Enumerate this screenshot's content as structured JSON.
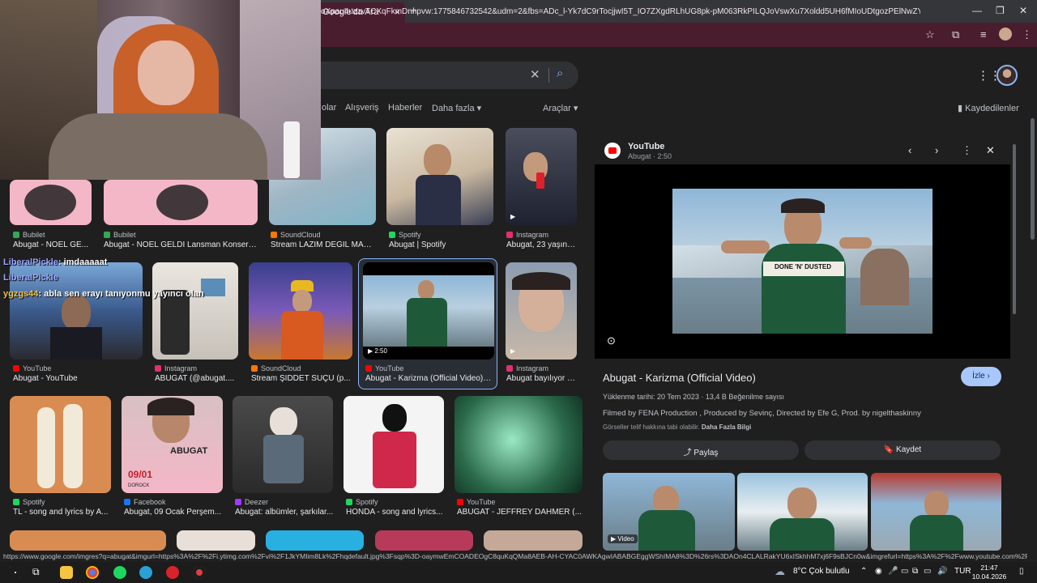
{
  "browser": {
    "tab_title": "Google'da Ara",
    "tab_close": "×",
    "new_tab": "+",
    "url": "oXpau4uzzvTCXqFkmDnnpvw:1775846732542&udm=2&fbs=ADc_l-Yk7dC9rTocjjwI5T_IO7ZXgdRLhUG8pk-pM063RkPILQJoVswXu7Xoldd5UH6fMIoUDtgozPElNwZYSjs_WJgHI0H2...",
    "window_controls": [
      "—",
      "❐",
      "✕"
    ]
  },
  "google": {
    "nav_items": [
      "olar",
      "Alışveriş",
      "Haberler",
      "Daha fazla ▾"
    ],
    "tools": "Araçlar ▾",
    "saved": "Kaydedilenler"
  },
  "results": [
    {
      "source": "Bubilet",
      "caption": "Abugat - NOEL GE...",
      "fav_color": "#34a853"
    },
    {
      "source": "Bubilet",
      "caption": "Abugat - NOEL GELDİ Lansman Konseri ...",
      "fav_color": "#34a853"
    },
    {
      "source": "SoundCloud",
      "caption": "Stream LAZIM DEĞİL MAG...",
      "fav_color": "#ff7700"
    },
    {
      "source": "Spotify",
      "caption": "Abugat | Spotify",
      "fav_color": "#1ed760"
    },
    {
      "source": "Instagram",
      "caption": "Abugat, 23 yaşınd...",
      "fav_color": "#e1306c"
    },
    {
      "source": "YouTube",
      "caption": "Abugat - YouTube",
      "fav_color": "#ff0000"
    },
    {
      "source": "Instagram",
      "caption": "ABUGAT (@abugat....",
      "fav_color": "#e1306c"
    },
    {
      "source": "SoundCloud",
      "caption": "Stream ŞİDDET SUÇU (p...",
      "fav_color": "#ff7700"
    },
    {
      "source": "YouTube",
      "caption": "Abugat - Karizma (Official Video) -...",
      "fav_color": "#ff0000",
      "duration": "▶ 2:50"
    },
    {
      "source": "Instagram",
      "caption": "Abugat bayılıyor #...",
      "fav_color": "#e1306c"
    },
    {
      "source": "Spotify",
      "caption": "TL - song and lyrics by A...",
      "fav_color": "#1ed760"
    },
    {
      "source": "Facebook",
      "caption": "Abugat, 09 Ocak Perşem...",
      "fav_color": "#1877f2"
    },
    {
      "source": "Deezer",
      "caption": "Abugat: albümler, şarkılar...",
      "fav_color": "#a238ff"
    },
    {
      "source": "Spotify",
      "caption": "HONDA - song and lyrics...",
      "fav_color": "#1ed760"
    },
    {
      "source": "YouTube",
      "caption": "ABUGAT - JEFFREY DAHMER (...",
      "fav_color": "#ff0000"
    }
  ],
  "poster": {
    "date": "09/01",
    "name": "ABUGAT",
    "brand": "DOROCK"
  },
  "panel": {
    "site": "YouTube",
    "sub": "Abugat · 2:50",
    "title": "Abugat - Karizma (Official Video)",
    "follow": "İzle ›",
    "meta": "Yüklenme tarihi: 20 Tem 2023 · 13,4 B Beğenilme sayısı",
    "credits": "Filmed by FENA Production , Produced by Sevinç, Directed by Efe G, Prod. by nigelthaskinny",
    "copyright": "Görseller telif hakkına tabi olabilir.",
    "more_info": "Daha Fazla Bilgi",
    "share": "⤴ Paylaş",
    "save": "🔖 Kaydet",
    "video_label": "▶ Video",
    "shirt_text": "DONE 'N' DUSTED"
  },
  "status_url": "https://www.google.com/imgres?q=abugat&imgurl=https%3A%2F%2Fi.ytimg.com%2Fvi%2F1JkYMIim8Lk%2Fhqdefault.jpg%3Fsqp%3D-oaymwEmCOADEOgC8quKqQMa8AEB-AH-CYAC0AWKAgwIABABGEggWShIMA8%3D%26rs%3DAOn4CLALRakYU6xISkhhM7xj6F9sBJCn0w&imgrefurl=https%3A%2F%2Fwww.youtube.com%2Fwatch%3Fv%3D1JkYMIim...",
  "taskbar": {
    "weather": "8°C  Çok bulutlu",
    "lang": "TUR",
    "time": "21:47",
    "date": "10.04.2026"
  },
  "chat": [
    {
      "user": "LiberalPickle",
      "message": ": imdaaaaat"
    },
    {
      "user": "LiberalPickle",
      "message": ""
    },
    {
      "user": "ygzgs44",
      "message": ": abla sen erayı tanıyonmu yayıncı olan"
    }
  ]
}
